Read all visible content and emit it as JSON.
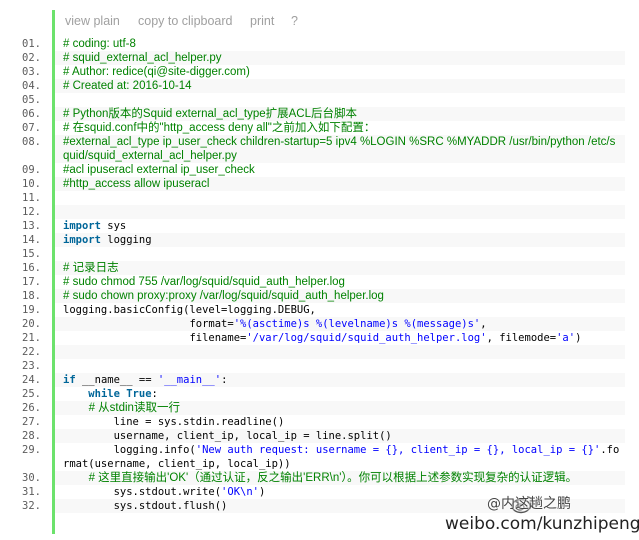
{
  "toolbar": {
    "view_plain": "view plain",
    "copy": "copy to clipboard",
    "print": "print",
    "help": "?"
  },
  "lines": [
    {
      "n": "01.",
      "segs": [
        {
          "t": "# coding: utf-8",
          "c": "cm"
        }
      ]
    },
    {
      "n": "02.",
      "segs": [
        {
          "t": "# squid_external_acl_helper.py",
          "c": "cm"
        }
      ]
    },
    {
      "n": "03.",
      "segs": [
        {
          "t": "# Author: redice(qi@site-digger.com)",
          "c": "cm"
        }
      ]
    },
    {
      "n": "04.",
      "segs": [
        {
          "t": "# Created at: 2016-10-14",
          "c": "cm"
        }
      ]
    },
    {
      "n": "05.",
      "segs": []
    },
    {
      "n": "06.",
      "segs": [
        {
          "t": "# Python版本的Squid external_acl_type扩展ACL后台脚本",
          "c": "cm"
        }
      ]
    },
    {
      "n": "07.",
      "segs": [
        {
          "t": "# 在squid.conf中的\"http_access deny all\"之前加入如下配置：",
          "c": "cm"
        }
      ]
    },
    {
      "n": "08.",
      "segs": [
        {
          "t": "#external_acl_type ip_user_check children-startup=5 ipv4 %LOGIN %SRC %MYADDR /usr/bin/python /etc/squid/squid_external_acl_helper.py",
          "c": "cm"
        }
      ]
    },
    {
      "n": "09.",
      "segs": [
        {
          "t": "#acl ipuseracl external ip_user_check",
          "c": "cm"
        }
      ]
    },
    {
      "n": "10.",
      "segs": [
        {
          "t": "#http_access allow ipuseracl",
          "c": "cm"
        }
      ]
    },
    {
      "n": "11.",
      "segs": []
    },
    {
      "n": "12.",
      "segs": []
    },
    {
      "n": "13.",
      "segs": [
        {
          "t": "import",
          "c": "kw"
        },
        {
          "t": " sys",
          "c": ""
        }
      ]
    },
    {
      "n": "14.",
      "segs": [
        {
          "t": "import",
          "c": "kw"
        },
        {
          "t": " logging",
          "c": ""
        }
      ]
    },
    {
      "n": "15.",
      "segs": []
    },
    {
      "n": "16.",
      "segs": [
        {
          "t": "# 记录日志",
          "c": "cm"
        }
      ]
    },
    {
      "n": "17.",
      "segs": [
        {
          "t": "# sudo chmod 755 /var/log/squid/squid_auth_helper.log",
          "c": "cm"
        }
      ]
    },
    {
      "n": "18.",
      "segs": [
        {
          "t": "# sudo chown proxy:proxy /var/log/squid/squid_auth_helper.log",
          "c": "cm"
        }
      ]
    },
    {
      "n": "19.",
      "segs": [
        {
          "t": "logging.basicConfig(level=logging.DEBUG,",
          "c": ""
        }
      ]
    },
    {
      "n": "20.",
      "segs": [
        {
          "t": "                    format=",
          "c": ""
        },
        {
          "t": "'%(asctime)s %(levelname)s %(message)s'",
          "c": "st"
        },
        {
          "t": ",",
          "c": ""
        }
      ]
    },
    {
      "n": "21.",
      "segs": [
        {
          "t": "                    filename=",
          "c": ""
        },
        {
          "t": "'/var/log/squid/squid_auth_helper.log'",
          "c": "st"
        },
        {
          "t": ", filemode=",
          "c": ""
        },
        {
          "t": "'a'",
          "c": "st"
        },
        {
          "t": ")",
          "c": ""
        }
      ]
    },
    {
      "n": "22.",
      "segs": []
    },
    {
      "n": "23.",
      "segs": []
    },
    {
      "n": "24.",
      "segs": [
        {
          "t": "if",
          "c": "kw"
        },
        {
          "t": " __name__ == ",
          "c": ""
        },
        {
          "t": "'__main__'",
          "c": "st"
        },
        {
          "t": ":",
          "c": ""
        }
      ]
    },
    {
      "n": "25.",
      "segs": [
        {
          "t": "    ",
          "c": ""
        },
        {
          "t": "while",
          "c": "kw"
        },
        {
          "t": " ",
          "c": ""
        },
        {
          "t": "True",
          "c": "kw"
        },
        {
          "t": ":",
          "c": ""
        }
      ]
    },
    {
      "n": "26.",
      "segs": [
        {
          "t": "        # 从stdin读取一行",
          "c": "cm"
        }
      ]
    },
    {
      "n": "27.",
      "segs": [
        {
          "t": "        line = sys.stdin.readline()",
          "c": ""
        }
      ]
    },
    {
      "n": "28.",
      "segs": [
        {
          "t": "        username, client_ip, local_ip = line.split()",
          "c": ""
        }
      ]
    },
    {
      "n": "29.",
      "segs": [
        {
          "t": "        logging.info(",
          "c": ""
        },
        {
          "t": "'New auth request: username = {}, client_ip = {}, local_ip = {}'",
          "c": "st"
        },
        {
          "t": ".format(username, client_ip, local_ip))",
          "c": ""
        }
      ]
    },
    {
      "n": "30.",
      "segs": [
        {
          "t": "        # 这里直接输出'OK'（通过认证，反之输出'ERR\\n'）。你可以根据上述参数实现复杂的认证逻辑。",
          "c": "cm"
        }
      ]
    },
    {
      "n": "31.",
      "segs": [
        {
          "t": "        sys.stdout.write(",
          "c": ""
        },
        {
          "t": "'OK\\n'",
          "c": "st"
        },
        {
          "t": ")",
          "c": ""
        }
      ]
    },
    {
      "n": "32.",
      "segs": [
        {
          "t": "        sys.stdout.flush()",
          "c": ""
        }
      ]
    }
  ],
  "watermark": {
    "handle": "@内这趟之鹏",
    "url": "weibo.com/kunzhipeng"
  }
}
